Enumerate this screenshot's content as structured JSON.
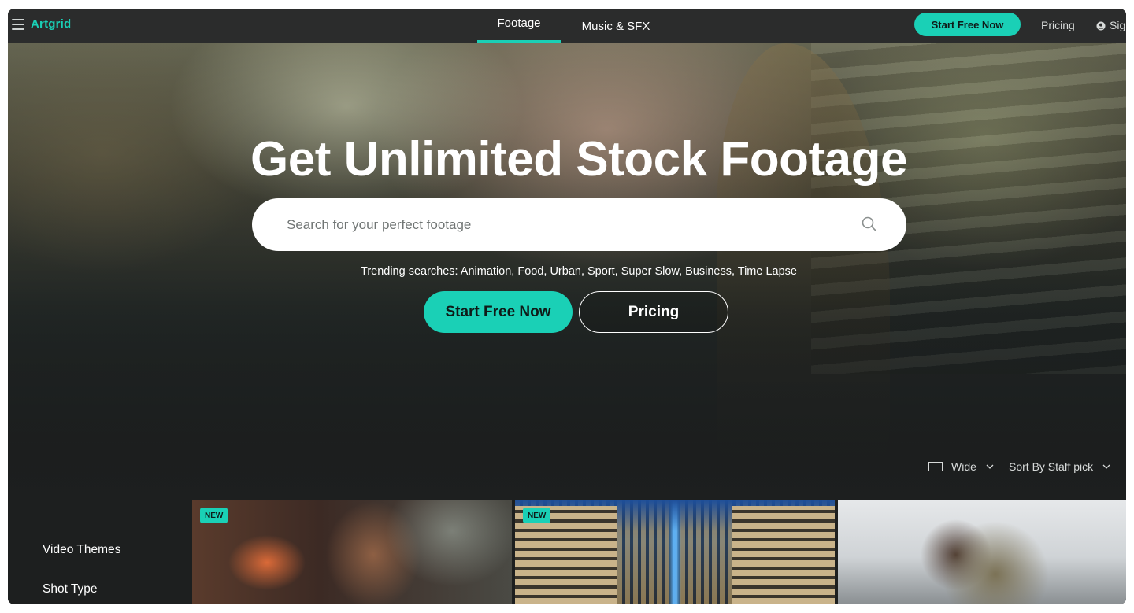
{
  "brand": {
    "logo_text": "Artgrid",
    "accent_color": "#1ad0b6"
  },
  "nav": {
    "menu_icon": "hamburger-icon",
    "tabs": [
      {
        "label": "Footage",
        "active": true
      },
      {
        "label": "Music & SFX",
        "active": false
      }
    ],
    "cta_label": "Start Free Now",
    "pricing_label": "Pricing",
    "signin_label": "Sig",
    "signin_icon": "user-circle-icon"
  },
  "hero": {
    "title": "Get Unlimited Stock Footage",
    "search": {
      "placeholder": "Search for your perfect footage",
      "icon": "search-icon"
    },
    "trending_text": "Trending searches: Animation, Food, Urban, Sport, Super Slow, Business, Time Lapse",
    "primary_button": "Start Free Now",
    "secondary_button": "Pricing"
  },
  "toolbar": {
    "view_label": "Wide",
    "sort_label": "Sort By Staff pick"
  },
  "sidebar": {
    "items": [
      {
        "label": "Video Themes"
      },
      {
        "label": "Shot Type"
      }
    ]
  },
  "thumbnails": [
    {
      "badge": "NEW"
    },
    {
      "badge": "NEW"
    },
    {
      "badge": ""
    }
  ]
}
